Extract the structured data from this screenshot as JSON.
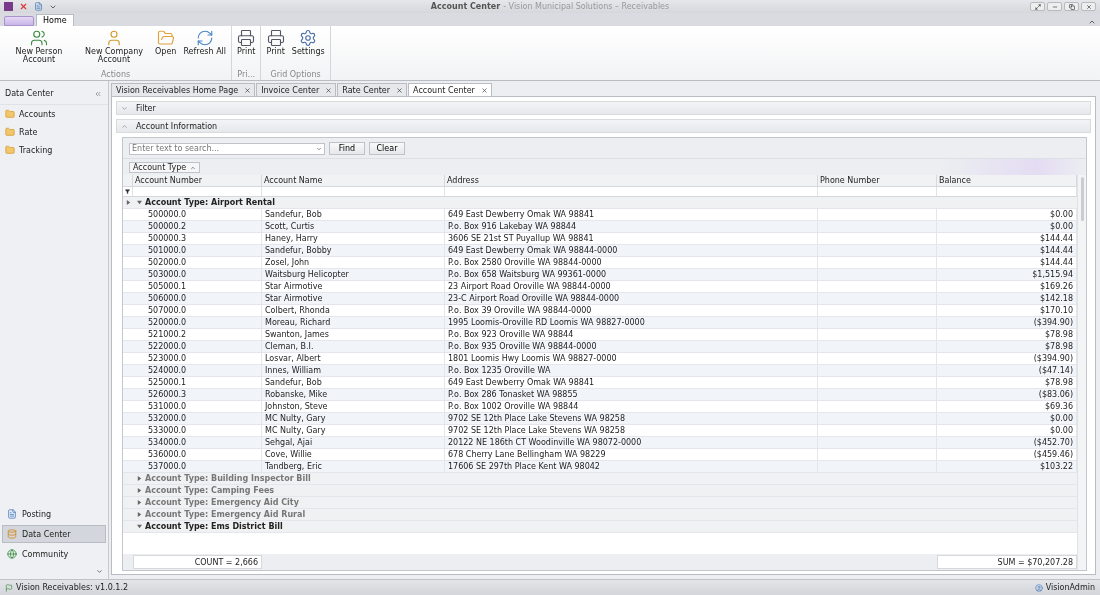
{
  "window": {
    "title": "Account Center",
    "subtitle": "- Vision Municipal Solutions – Receivables"
  },
  "ribbon": {
    "tabs": [
      {
        "label": "Home",
        "selected": true
      }
    ],
    "groups": [
      {
        "label": "Actions",
        "buttons": [
          {
            "label": "New Person Account",
            "kind": "people"
          },
          {
            "label": "New Company Account",
            "kind": "person"
          },
          {
            "label": "Open",
            "kind": "folder"
          },
          {
            "label": "Refresh All",
            "kind": "refresh"
          }
        ]
      },
      {
        "label": "Pri...",
        "buttons": [
          {
            "label": "Print",
            "kind": "print"
          }
        ]
      },
      {
        "label": "Grid Options",
        "buttons": [
          {
            "label": "Print",
            "kind": "print"
          },
          {
            "label": "Settings",
            "kind": "settings"
          }
        ]
      }
    ]
  },
  "sidebar": {
    "title": "Data Center",
    "items": [
      {
        "label": "Accounts"
      },
      {
        "label": "Rate"
      },
      {
        "label": "Tracking"
      }
    ],
    "nav": [
      {
        "label": "Posting",
        "kind": "posting",
        "selected": false
      },
      {
        "label": "Data Center",
        "kind": "data",
        "selected": true
      },
      {
        "label": "Community",
        "kind": "community",
        "selected": false
      }
    ]
  },
  "doc_tabs": [
    {
      "label": "Vision Receivables Home Page",
      "selected": false
    },
    {
      "label": "Invoice Center",
      "selected": false
    },
    {
      "label": "Rate Center",
      "selected": false
    },
    {
      "label": "Account Center",
      "selected": true
    }
  ],
  "panels": [
    {
      "title": "Filter",
      "expanded": false
    },
    {
      "title": "Account Information",
      "expanded": true
    }
  ],
  "search": {
    "placeholder": "Enter text to search...",
    "buttons": [
      "Find",
      "Clear"
    ]
  },
  "group_by": "Account Type",
  "columns": [
    "Account Number",
    "Account Name",
    "Address",
    "Phone Number",
    "Balance"
  ],
  "groups": [
    {
      "label": "Account Type: Airport Rental",
      "expanded": true,
      "current": true,
      "rows": [
        [
          "500000.0",
          "Sandefur, Bob",
          "649 East Dewberry Omak WA 98841",
          "$0.00"
        ],
        [
          "500000.2",
          "Scott, Curtis",
          "P.o. Box 916 Lakebay WA 98844",
          "$0.00"
        ],
        [
          "500000.3",
          "Haney, Harry",
          "3606 SE 21st ST Puyallup WA 98841",
          "$144.44"
        ],
        [
          "501000.0",
          "Sandefur, Bobby",
          "649 East Dewberry Omak WA 98844-0000",
          "$144.44"
        ],
        [
          "502000.0",
          "Zosel, John",
          "P.o. Box 2580 Oroville WA 98844-0000",
          "$144.44"
        ],
        [
          "503000.0",
          "Waitsburg Helicopter",
          "P.o. Box 658 Waitsburg WA 99361-0000",
          "$1,515.94"
        ],
        [
          "505000.1",
          "Star Airmotive",
          "23 Airport Road Oroville WA 98844-0000",
          "$169.26"
        ],
        [
          "506000.0",
          "Star Airmotive",
          "23-C Airport Road Oroville WA 98844-0000",
          "$142.18"
        ],
        [
          "507000.0",
          "Colbert, Rhonda",
          "P.o. Box 39 Oroville WA 98844-0000",
          "$170.10"
        ],
        [
          "520000.0",
          "Moreau, Richard",
          "1995 Loomis-Oroville RD Loomis WA 98827-0000",
          "($394.90)"
        ],
        [
          "521000.2",
          "Swanton, James",
          "P.o. Box 923 Oroville WA 98844",
          "$78.98"
        ],
        [
          "522000.0",
          "Cleman, B.I.",
          "P.o. Box 935 Oroville WA 98844-0000",
          "$78.98"
        ],
        [
          "523000.0",
          "Losvar, Albert",
          "1801 Loomis Hwy Loomis WA 98827-0000",
          "($394.90)"
        ],
        [
          "524000.0",
          "Innes, William",
          "P.o. Box 1235 Oroville WA",
          "($47.14)"
        ],
        [
          "525000.1",
          "Sandefur, Bob",
          "649 East Dewberry Omak WA 98841",
          "$78.98"
        ],
        [
          "526000.3",
          "Robanske, Mike",
          "P.o. Box 286 Tonasket WA 98855",
          "($83.06)"
        ],
        [
          "531000.0",
          "Johnston, Steve",
          "P.o. Box 1002 Oroville WA 98844",
          "$69.36"
        ],
        [
          "532000.0",
          "MC Nulty, Gary",
          "9702 SE 12th Place Lake Stevens WA 98258",
          "$0.00"
        ],
        [
          "533000.0",
          "MC Nulty, Gary",
          "9702 SE 12th Place Lake Stevens WA 98258",
          "$0.00"
        ],
        [
          "534000.0",
          "Sehgal, Ajai",
          "20122 NE 186th CT Woodinville WA 98072-0000",
          "($452.70)"
        ],
        [
          "536000.0",
          "Cove, Willie",
          "678 Cherry Lane Bellingham WA 98229",
          "($459.46)"
        ],
        [
          "537000.0",
          "Tandberg, Eric",
          "17606 SE 297th Place Kent WA 98042",
          "$103.22"
        ]
      ]
    },
    {
      "label": "Account Type: Building Inspector Bill",
      "expanded": false,
      "current": false
    },
    {
      "label": "Account Type: Camping Fees",
      "expanded": false,
      "current": false
    },
    {
      "label": "Account Type: Emergency Aid City",
      "expanded": false,
      "current": false
    },
    {
      "label": "Account Type: Emergency Aid Rural",
      "expanded": false,
      "current": false
    },
    {
      "label": "Account Type: Ems District Bill",
      "expanded": true,
      "current": false
    }
  ],
  "footer": {
    "count": "COUNT = 2,666",
    "sum": "SUM = $70,207.28"
  },
  "status": {
    "version": "Vision Receivables: v1.0.1.2",
    "user": "VisionAdmin"
  }
}
